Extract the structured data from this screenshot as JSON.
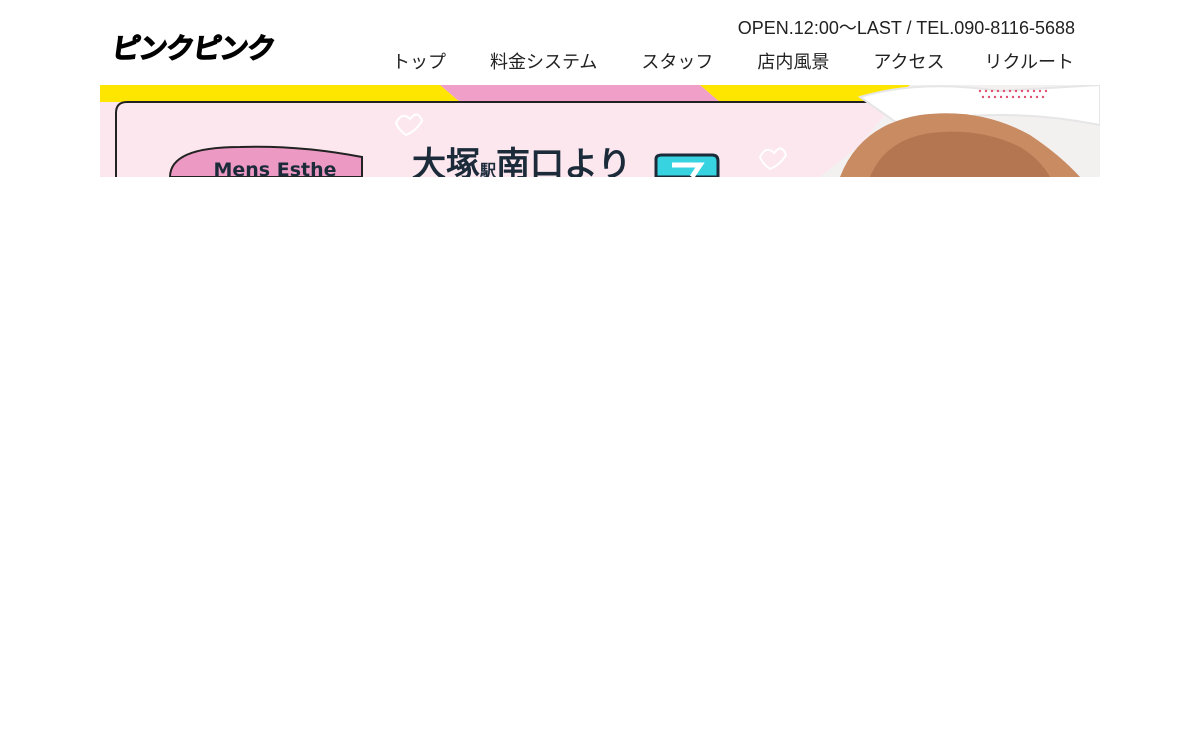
{
  "header": {
    "logo_text": "ピンクピンク",
    "contact": "OPEN.12:00〜LAST / TEL.090-8116-5688"
  },
  "nav": {
    "items": [
      {
        "label": "トップ"
      },
      {
        "label": "料金システム"
      },
      {
        "label": "スタッフ"
      },
      {
        "label": "店内風景"
      },
      {
        "label": "アクセス"
      },
      {
        "label": "リクルート"
      }
    ]
  },
  "hero": {
    "badge_text": "Mens Esthe",
    "headline_main": "大塚",
    "headline_small": "駅",
    "headline_rest": "南口より",
    "colors": {
      "yellow": "#ffe600",
      "pink": "#f0a0c8",
      "panel": "#fde7ef",
      "badge": "#ec9ac4",
      "cyan": "#38d3e0"
    }
  }
}
